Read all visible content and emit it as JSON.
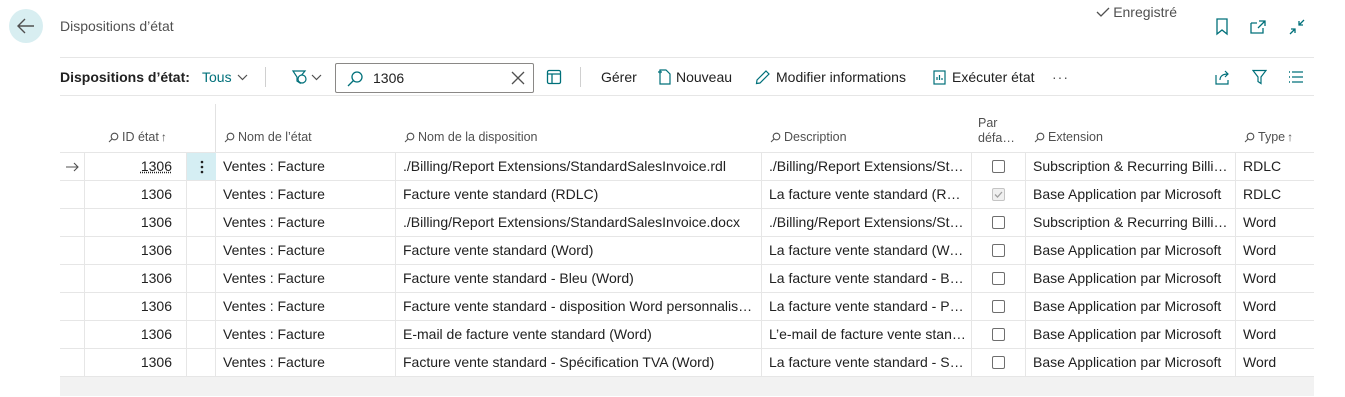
{
  "header": {
    "title": "Dispositions d’état",
    "saved_label": "Enregistré"
  },
  "toolbar": {
    "view_label": "Dispositions d’état:",
    "filter_label": "Tous",
    "search_value": "1306",
    "gerer": "Gérer",
    "nouveau": "Nouveau",
    "modifier": "Modifier informations",
    "executer": "Exécuter état",
    "more": "···"
  },
  "columns": {
    "id": "ID état",
    "nom_etat": "Nom de l’état",
    "nom_disposition": "Nom de la disposition",
    "description": "Description",
    "par_defaut_1": "Par",
    "par_defaut_2": "défa…",
    "extension": "Extension",
    "type": "Type"
  },
  "rows": [
    {
      "id": "1306",
      "nom_etat": "Ventes : Facture",
      "nom_disposition": "./Billing/Report Extensions/StandardSalesInvoice.rdl",
      "description": "./Billing/Report Extensions/Sta…",
      "par_defaut": false,
      "extension": "Subscription & Recurring Billin…",
      "type": "RDLC"
    },
    {
      "id": "1306",
      "nom_etat": "Ventes : Facture",
      "nom_disposition": "Facture vente standard (RDLC)",
      "description": "La facture vente standard (RDL…",
      "par_defaut": true,
      "extension": "Base Application par Microsoft",
      "type": "RDLC"
    },
    {
      "id": "1306",
      "nom_etat": "Ventes : Facture",
      "nom_disposition": "./Billing/Report Extensions/StandardSalesInvoice.docx",
      "description": "./Billing/Report Extensions/Sta…",
      "par_defaut": false,
      "extension": "Subscription & Recurring Billin…",
      "type": "Word"
    },
    {
      "id": "1306",
      "nom_etat": "Ventes : Facture",
      "nom_disposition": "Facture vente standard (Word)",
      "description": "La facture vente standard (Wor…",
      "par_defaut": false,
      "extension": "Base Application par Microsoft",
      "type": "Word"
    },
    {
      "id": "1306",
      "nom_etat": "Ventes : Facture",
      "nom_disposition": "Facture vente standard - Bleu (Word)",
      "description": "La facture vente standard - Ble…",
      "par_defaut": false,
      "extension": "Base Application par Microsoft",
      "type": "Word"
    },
    {
      "id": "1306",
      "nom_etat": "Ventes : Facture",
      "nom_disposition": "Facture vente standard - disposition Word personnalisa…",
      "description": "La facture vente standard - Per…",
      "par_defaut": false,
      "extension": "Base Application par Microsoft",
      "type": "Word"
    },
    {
      "id": "1306",
      "nom_etat": "Ventes : Facture",
      "nom_disposition": "E-mail de facture vente standard (Word)",
      "description": "L’e-mail de facture vente stand…",
      "par_defaut": false,
      "extension": "Base Application par Microsoft",
      "type": "Word"
    },
    {
      "id": "1306",
      "nom_etat": "Ventes : Facture",
      "nom_disposition": "Facture vente standard - Spécification TVA (Word)",
      "description": "La facture vente standard - Sp…",
      "par_defaut": false,
      "extension": "Base Application par Microsoft",
      "type": "Word"
    }
  ],
  "colors": {
    "accent": "#00707a",
    "selected_cell": "#d5eef3",
    "back_button": "#d8eef1"
  }
}
